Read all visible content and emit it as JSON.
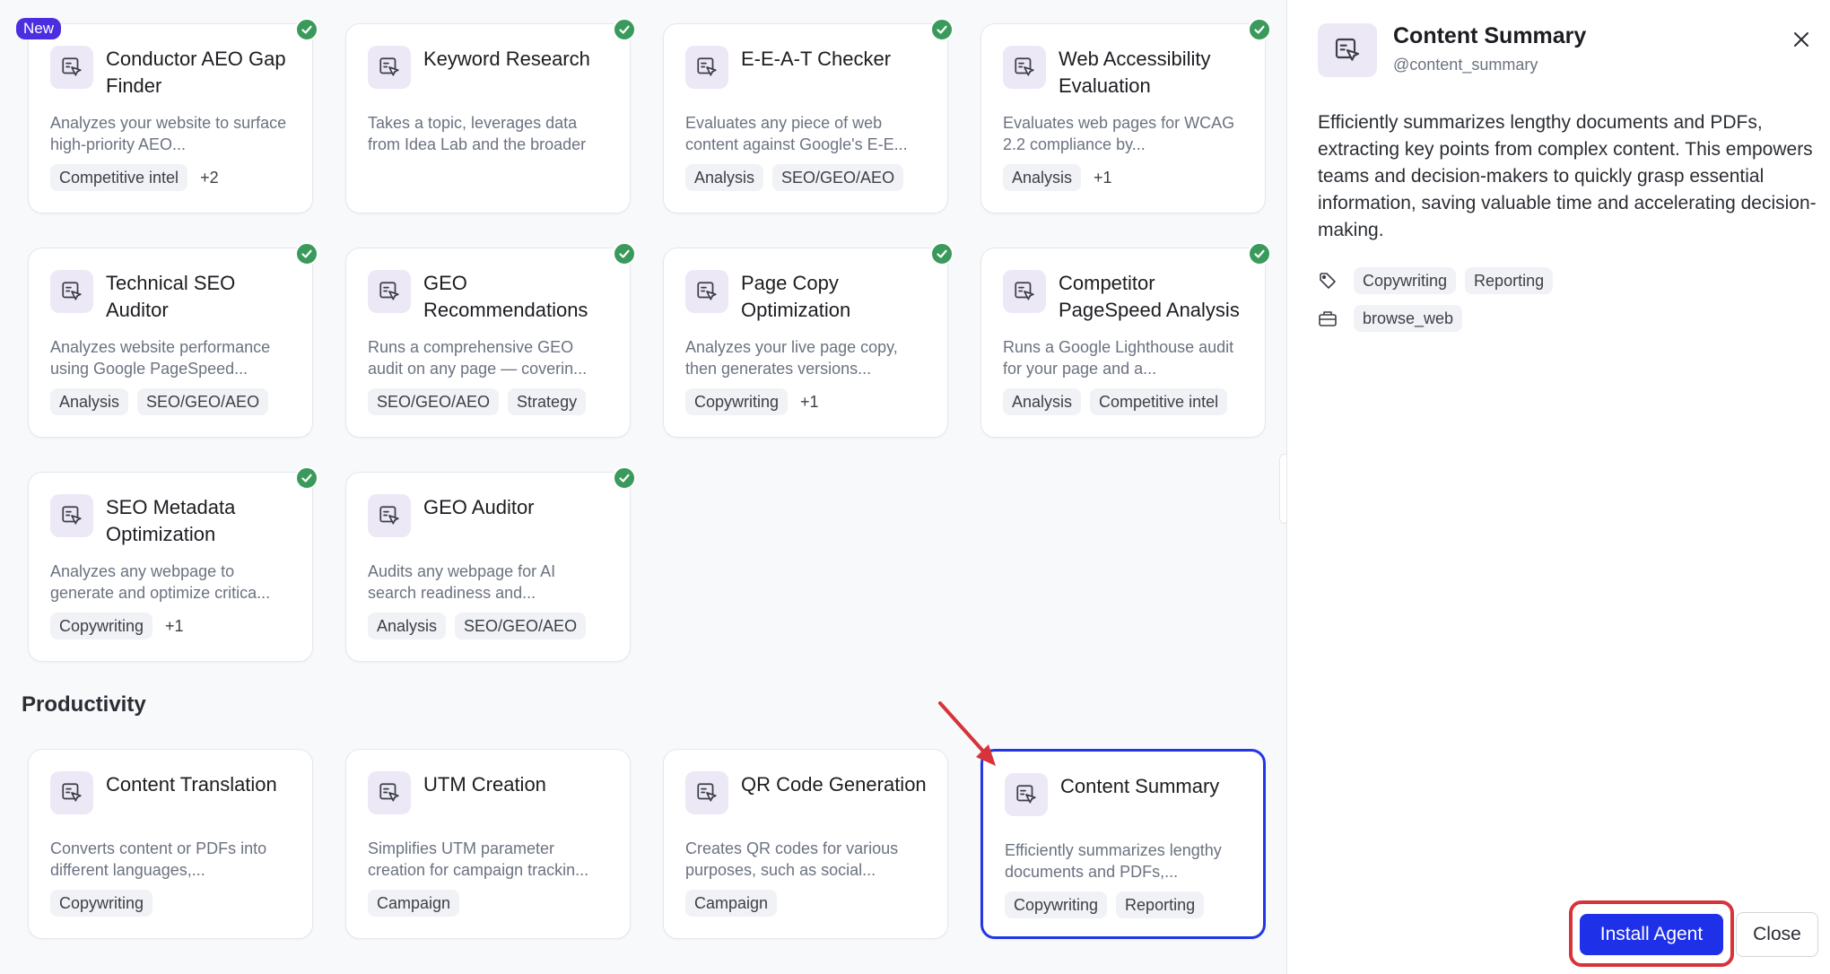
{
  "colors": {
    "accent": "#1f31e8",
    "check_green": "#3a9a5b",
    "new_badge": "#4a2ee0",
    "annotation_red": "#d6343a",
    "icon_bg": "#ece8f6"
  },
  "new_badge": "New",
  "cards": [
    {
      "title": "Conductor AEO Gap Finder",
      "desc": "Analyzes your website to surface high-priority AEO...",
      "tags": [
        "Competitive intel"
      ],
      "more": "+2",
      "installed": true
    },
    {
      "title": "Keyword Research",
      "desc": "Takes a topic, leverages data from Idea Lab and the broader web, and returns a curated li...",
      "tags": [],
      "more": "",
      "installed": true
    },
    {
      "title": "E-E-A-T Checker",
      "desc": "Evaluates any piece of web content against Google's E-E...",
      "tags": [
        "Analysis",
        "SEO/GEO/AEO"
      ],
      "more": "",
      "installed": true
    },
    {
      "title": "Web Accessibility Evaluation",
      "desc": "Evaluates web pages for WCAG 2.2 compliance by...",
      "tags": [
        "Analysis"
      ],
      "more": "+1",
      "installed": true
    },
    {
      "title": "Technical SEO Auditor",
      "desc": "Analyzes website performance using Google PageSpeed...",
      "tags": [
        "Analysis",
        "SEO/GEO/AEO"
      ],
      "more": "",
      "installed": true
    },
    {
      "title": "GEO Recommendations",
      "desc": "Runs a comprehensive GEO audit on any page — coverin...",
      "tags": [
        "SEO/GEO/AEO",
        "Strategy"
      ],
      "more": "",
      "installed": true
    },
    {
      "title": "Page Copy Optimization",
      "desc": "Analyzes your live page copy, then generates versions...",
      "tags": [
        "Copywriting"
      ],
      "more": "+1",
      "installed": true
    },
    {
      "title": "Competitor PageSpeed Analysis",
      "desc": "Runs a Google Lighthouse audit for your page and a...",
      "tags": [
        "Analysis",
        "Competitive intel"
      ],
      "more": "",
      "installed": true
    },
    {
      "title": "SEO Metadata Optimization",
      "desc": "Analyzes any webpage to generate and optimize critica...",
      "tags": [
        "Copywriting"
      ],
      "more": "+1",
      "installed": true
    },
    {
      "title": "GEO Auditor",
      "desc": "Audits any webpage for AI search readiness and...",
      "tags": [
        "Analysis",
        "SEO/GEO/AEO"
      ],
      "more": "",
      "installed": true
    }
  ],
  "productivity": {
    "title": "Productivity",
    "cards": [
      {
        "title": "Content Translation",
        "desc": "Converts content or PDFs into different languages,...",
        "tags": [
          "Copywriting"
        ],
        "more": ""
      },
      {
        "title": "UTM Creation",
        "desc": "Simplifies UTM parameter creation for campaign trackin...",
        "tags": [
          "Campaign"
        ],
        "more": ""
      },
      {
        "title": "QR Code Generation",
        "desc": "Creates QR codes for various purposes, such as social...",
        "tags": [
          "Campaign"
        ],
        "more": ""
      },
      {
        "title": "Content Summary",
        "desc": "Efficiently summarizes lengthy documents and PDFs,...",
        "tags": [
          "Copywriting",
          "Reporting"
        ],
        "more": "",
        "selected": true
      }
    ]
  },
  "panel": {
    "title": "Content Summary",
    "handle": "@content_summary",
    "description": "Efficiently summarizes lengthy documents and PDFs, extracting key points from complex content. This empowers teams and decision-makers to quickly grasp essential information, saving valuable time and accelerating decision-making.",
    "tags": [
      "Copywriting",
      "Reporting"
    ],
    "tools": [
      "browse_web"
    ],
    "install_label": "Install Agent",
    "close_label": "Close"
  }
}
